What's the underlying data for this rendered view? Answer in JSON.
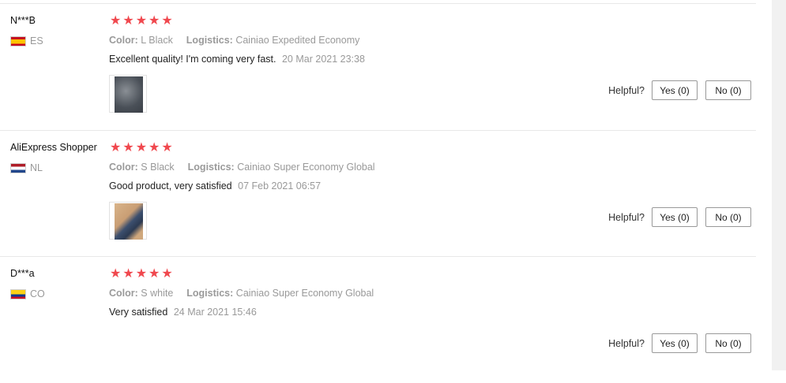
{
  "reviews": [
    {
      "name": "N***B",
      "country_code": "ES",
      "flag": "flag-es",
      "stars": 5,
      "color_label": "Color:",
      "color_value": "L Black",
      "logistics_label": "Logistics:",
      "logistics_value": "Cainiao Expedited Economy",
      "text": "Excellent quality! I'm coming very fast.",
      "date": "20 Mar 2021 23:38",
      "has_photo": true,
      "helpful_label": "Helpful?",
      "yes_label": "Yes (0)",
      "no_label": "No (0)"
    },
    {
      "name": "AliExpress Shopper",
      "country_code": "NL",
      "flag": "flag-nl",
      "stars": 5,
      "color_label": "Color:",
      "color_value": "S Black",
      "logistics_label": "Logistics:",
      "logistics_value": "Cainiao Super Economy Global",
      "text": "Good product, very satisfied",
      "date": "07 Feb 2021 06:57",
      "has_photo": true,
      "helpful_label": "Helpful?",
      "yes_label": "Yes (0)",
      "no_label": "No (0)"
    },
    {
      "name": "D***a",
      "country_code": "CO",
      "flag": "flag-co",
      "stars": 5,
      "color_label": "Color:",
      "color_value": "S white",
      "logistics_label": "Logistics:",
      "logistics_value": "Cainiao Super Economy Global",
      "text": "Very satisfied",
      "date": "24 Mar 2021 15:46",
      "has_photo": false,
      "helpful_label": "Helpful?",
      "yes_label": "Yes (0)",
      "no_label": "No (0)"
    }
  ],
  "colors": {
    "star": "#f0484e",
    "muted_text": "#999999",
    "divider": "#e8e8e8"
  },
  "icons": {
    "star": "star-icon"
  }
}
